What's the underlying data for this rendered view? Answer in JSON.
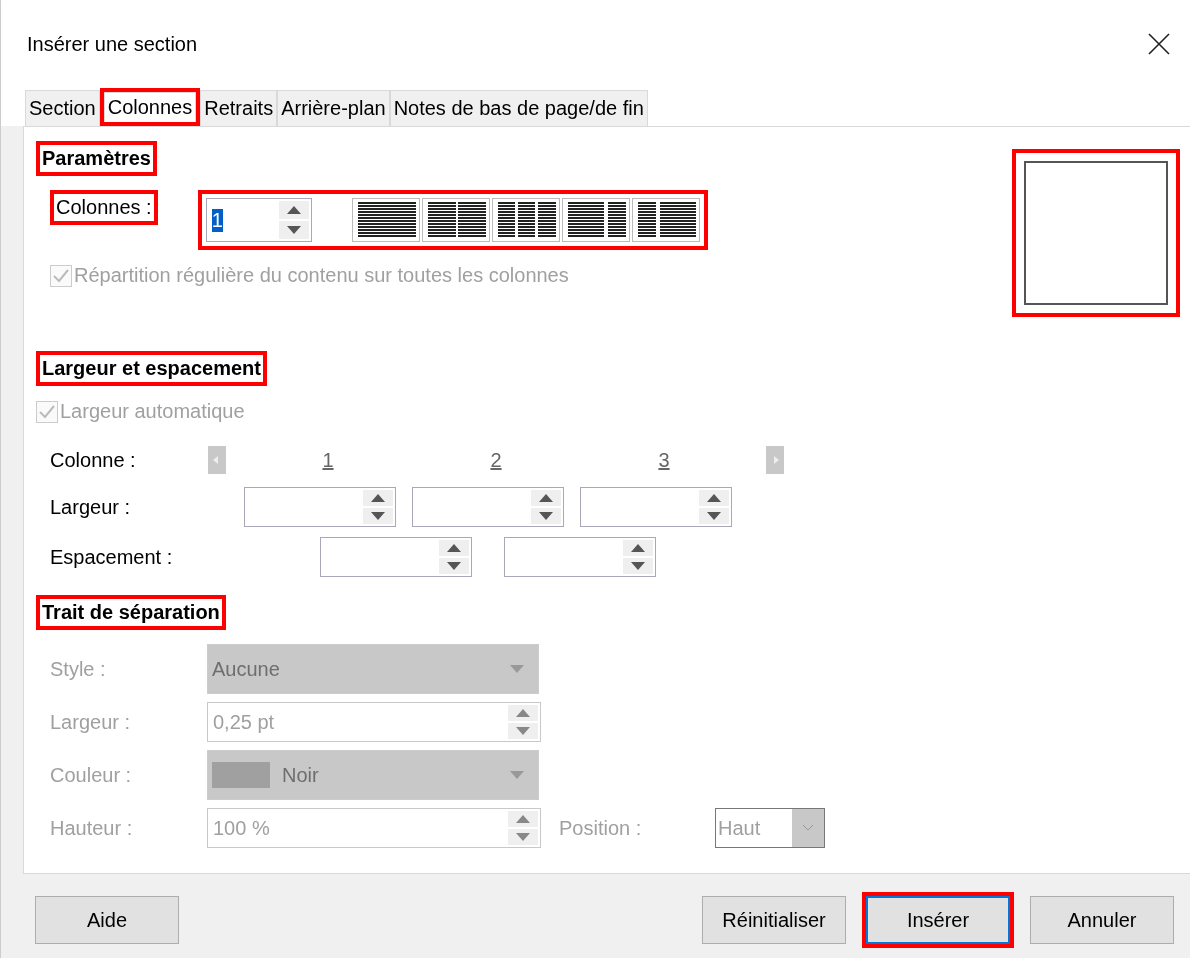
{
  "window": {
    "title": "Insérer une section"
  },
  "tabs": [
    {
      "label": "Section",
      "selected": false,
      "highlighted": false
    },
    {
      "label": "Colonnes",
      "selected": true,
      "highlighted": true
    },
    {
      "label": "Retraits",
      "selected": false,
      "highlighted": false
    },
    {
      "label": "Arrière-plan",
      "selected": false,
      "highlighted": false
    },
    {
      "label": "Notes de bas de page/de fin",
      "selected": false,
      "highlighted": false
    }
  ],
  "parameters": {
    "heading": "Paramètres",
    "heading_highlighted": true,
    "columns_label": "Colonnes :",
    "label_highlighted": true,
    "columns_value": "1",
    "value_selected": true,
    "controls_highlighted": true,
    "presets": [
      {
        "kind": "one"
      },
      {
        "kind": "two"
      },
      {
        "kind": "three"
      },
      {
        "kind": "left-wide"
      },
      {
        "kind": "right-wide"
      }
    ],
    "even_distribution": {
      "label": "Répartition régulière du contenu sur toutes les colonnes",
      "checked": true,
      "disabled": true
    }
  },
  "preview": {
    "highlighted": true
  },
  "width_spacing": {
    "heading": "Largeur et espacement",
    "heading_highlighted": true,
    "auto_width": {
      "label": "Largeur automatique",
      "checked": true,
      "disabled": true
    },
    "column_label": "Colonne :",
    "column_numbers": [
      "1",
      "2",
      "3"
    ],
    "width_label": "Largeur :",
    "width_fields": [
      {
        "kind": "spin"
      },
      {
        "kind": "spin"
      },
      {
        "kind": "spin"
      }
    ],
    "spacing_label": "Espacement :",
    "spacing_fields": [
      {
        "kind": "spin"
      },
      {
        "kind": "spin"
      }
    ]
  },
  "separator": {
    "heading": "Trait de séparation",
    "heading_highlighted": true,
    "rows": [
      {
        "kind": "dropdown",
        "label": "Style :",
        "value": "Aucune",
        "disabled": true
      },
      {
        "kind": "spin",
        "label": "Largeur :",
        "value": "0,25 pt",
        "disabled": true
      },
      {
        "kind": "color",
        "label": "Couleur :",
        "value": "Noir",
        "disabled": true
      },
      {
        "kind": "spin",
        "label": "Hauteur :",
        "value": "100 %",
        "disabled": true
      }
    ],
    "position": {
      "label": "Position :",
      "value": "Haut",
      "disabled": true
    }
  },
  "buttons": [
    {
      "label": "Aide",
      "highlighted": false,
      "default": false
    },
    {
      "label": "Réinitialiser",
      "highlighted": false,
      "default": false
    },
    {
      "label": "Insérer",
      "highlighted": true,
      "default": true
    },
    {
      "label": "Annuler",
      "highlighted": false,
      "default": false
    }
  ]
}
